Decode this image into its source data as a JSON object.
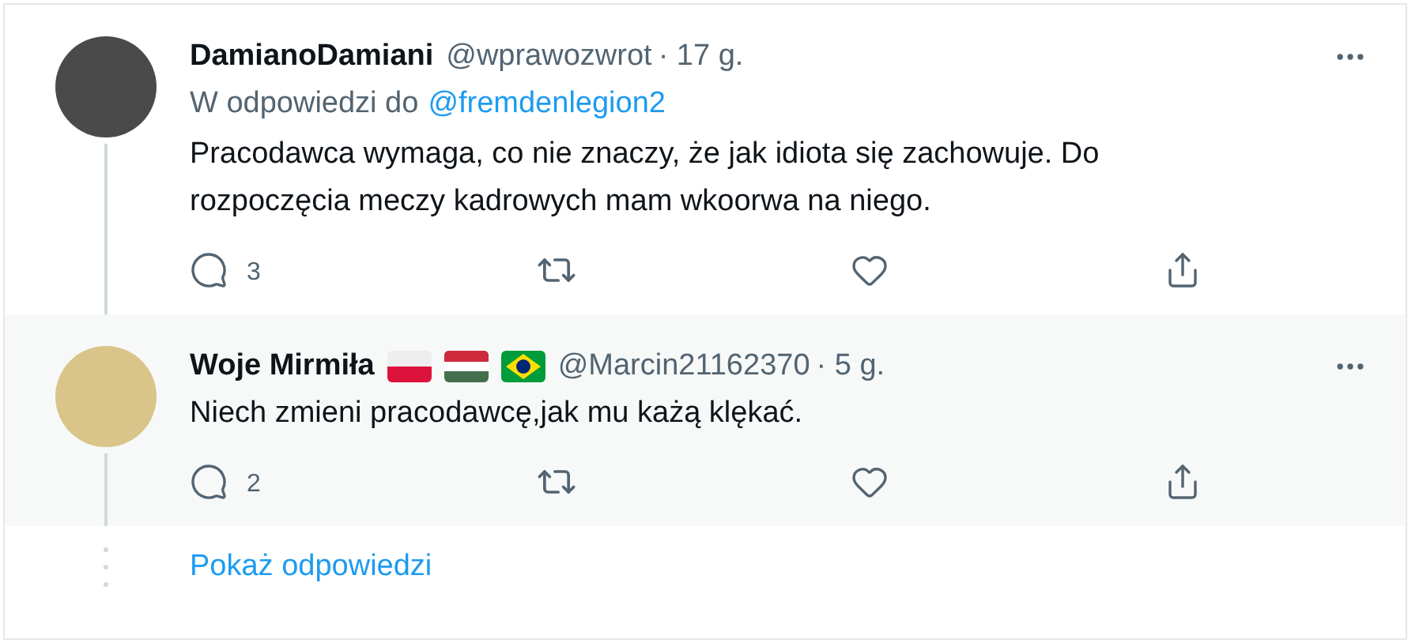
{
  "tweets": [
    {
      "name": "DamianoDamiani",
      "handle": "@wprawozwrot",
      "time": "· 17 g.",
      "reply_to": {
        "prefix": "W odpowiedzi do",
        "user": "@fremdenlegion2"
      },
      "text": "Pracodawca wymaga, co nie znaczy, że jak idiota się zachowuje. Do rozpoczęcia meczy kadrowych mam wkoorwa na niego.",
      "replies": "3",
      "color": "#ffffff"
    },
    {
      "name": "Woje Mirmiła",
      "flags": [
        {
          "kind": "poland"
        },
        {
          "kind": "hungary"
        },
        {
          "kind": "brazil"
        }
      ],
      "handle": "@Marcin21162370",
      "time": "· 5 g.",
      "text": "Niech zmieni pracodawcę,jak mu każą klękać.",
      "replies": "2",
      "color": "#f7f9f9"
    }
  ],
  "show_replies": "Pokaż odpowiedzi"
}
